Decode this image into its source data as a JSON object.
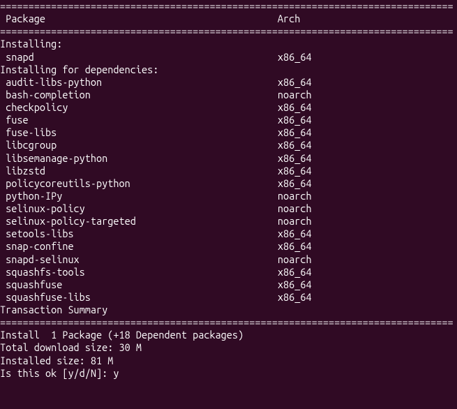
{
  "separator": "================================================================================",
  "header": {
    "package_label": "Package",
    "arch_label": "Arch"
  },
  "sections": {
    "installing_label": "Installing:",
    "installing": [
      {
        "name": "snapd",
        "arch": "x86_64"
      }
    ],
    "dependencies_label": "Installing for dependencies:",
    "dependencies": [
      {
        "name": "audit-libs-python",
        "arch": "x86_64"
      },
      {
        "name": "bash-completion",
        "arch": "noarch"
      },
      {
        "name": "checkpolicy",
        "arch": "x86_64"
      },
      {
        "name": "fuse",
        "arch": "x86_64"
      },
      {
        "name": "fuse-libs",
        "arch": "x86_64"
      },
      {
        "name": "libcgroup",
        "arch": "x86_64"
      },
      {
        "name": "libsemanage-python",
        "arch": "x86_64"
      },
      {
        "name": "libzstd",
        "arch": "x86_64"
      },
      {
        "name": "policycoreutils-python",
        "arch": "x86_64"
      },
      {
        "name": "python-IPy",
        "arch": "noarch"
      },
      {
        "name": "selinux-policy",
        "arch": "noarch"
      },
      {
        "name": "selinux-policy-targeted",
        "arch": "noarch"
      },
      {
        "name": "setools-libs",
        "arch": "x86_64"
      },
      {
        "name": "snap-confine",
        "arch": "x86_64"
      },
      {
        "name": "snapd-selinux",
        "arch": "noarch"
      },
      {
        "name": "squashfs-tools",
        "arch": "x86_64"
      },
      {
        "name": "squashfuse",
        "arch": "x86_64"
      },
      {
        "name": "squashfuse-libs",
        "arch": "x86_64"
      }
    ]
  },
  "footer": {
    "summary_label": "Transaction Summary",
    "install_line": "Install  1 Package (+18 Dependent packages)",
    "download_size_line": "Total download size: 30 M",
    "installed_size_line": "Installed size: 81 M",
    "prompt_label": "Is this ok [y/d/N]: ",
    "prompt_value": "y"
  }
}
